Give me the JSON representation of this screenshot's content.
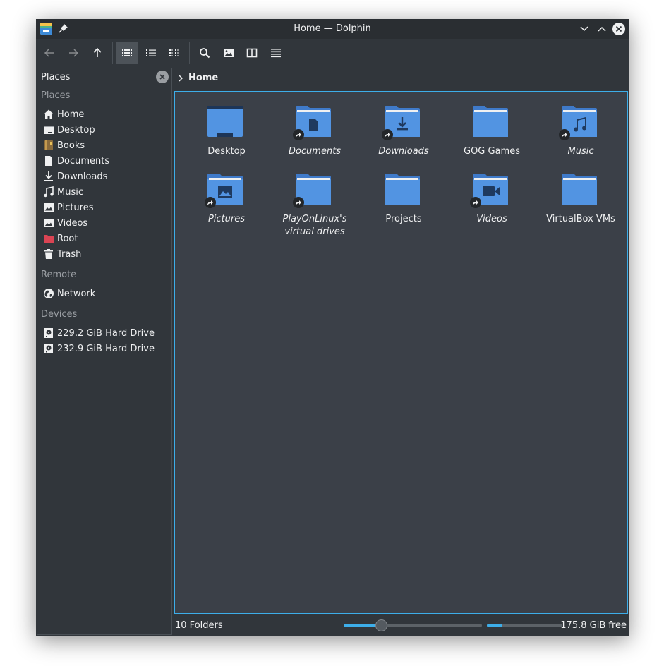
{
  "window": {
    "title": "Home — Dolphin"
  },
  "toolbar": {
    "back": "back-icon",
    "forward": "forward-icon",
    "up": "up-icon",
    "view_icons": "icons-view-icon",
    "view_details": "details-view-icon",
    "view_compact": "compact-view-icon",
    "search": "search-icon",
    "preview": "preview-icon",
    "split": "split-icon",
    "menu": "hamburger-menu-icon"
  },
  "places_panel": {
    "header": "Places",
    "groups": [
      {
        "title": "Places",
        "items": [
          {
            "label": "Home",
            "icon": "home-icon"
          },
          {
            "label": "Desktop",
            "icon": "desktop-icon"
          },
          {
            "label": "Books",
            "icon": "book-icon"
          },
          {
            "label": "Documents",
            "icon": "document-icon"
          },
          {
            "label": "Downloads",
            "icon": "download-icon"
          },
          {
            "label": "Music",
            "icon": "music-icon"
          },
          {
            "label": "Pictures",
            "icon": "picture-icon"
          },
          {
            "label": "Videos",
            "icon": "video-icon"
          },
          {
            "label": "Root",
            "icon": "red-folder-icon"
          },
          {
            "label": "Trash",
            "icon": "trash-icon"
          }
        ]
      },
      {
        "title": "Remote",
        "items": [
          {
            "label": "Network",
            "icon": "network-icon"
          }
        ]
      },
      {
        "title": "Devices",
        "items": [
          {
            "label": "229.2 GiB Hard Drive",
            "icon": "harddrive-icon"
          },
          {
            "label": "232.9 GiB Hard Drive",
            "icon": "harddrive-icon"
          }
        ]
      }
    ]
  },
  "breadcrumb": {
    "current": "Home"
  },
  "items": [
    {
      "name": "Desktop",
      "italic": false,
      "link": false,
      "emblem": "desktop"
    },
    {
      "name": "Documents",
      "italic": true,
      "link": true,
      "emblem": "document"
    },
    {
      "name": "Downloads",
      "italic": true,
      "link": true,
      "emblem": "download"
    },
    {
      "name": "GOG Games",
      "italic": false,
      "link": false,
      "emblem": "none"
    },
    {
      "name": "Music",
      "italic": true,
      "link": true,
      "emblem": "music"
    },
    {
      "name": "Pictures",
      "italic": true,
      "link": true,
      "emblem": "picture"
    },
    {
      "name": "PlayOnLinux's virtual drives",
      "italic": true,
      "link": true,
      "emblem": "none"
    },
    {
      "name": "Projects",
      "italic": false,
      "link": false,
      "emblem": "none"
    },
    {
      "name": "Videos",
      "italic": true,
      "link": true,
      "emblem": "video"
    },
    {
      "name": "VirtualBox VMs",
      "italic": false,
      "link": false,
      "emblem": "none",
      "focused": true
    }
  ],
  "statusbar": {
    "summary": "10 Folders",
    "zoom_fraction": 0.27,
    "free_space": "175.8 GiB free",
    "used_fraction": 0.21
  },
  "colors": {
    "accent": "#3daee9",
    "folder": "#5294e2",
    "folder_tab": "#3f7ac9",
    "emblem": "#1f3a5f"
  }
}
